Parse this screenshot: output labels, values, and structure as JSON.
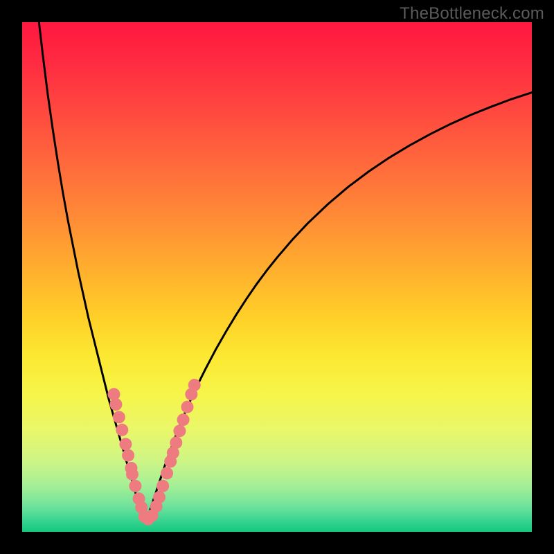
{
  "watermark": "TheBottleneck.com",
  "colors": {
    "curve_stroke": "#000000",
    "dot_fill": "#ee7b80",
    "dot_stroke": "#ee7b80",
    "background_black": "#000000"
  },
  "chart_data": {
    "type": "line",
    "title": "",
    "xlabel": "",
    "ylabel": "",
    "xlim": [
      0,
      100
    ],
    "ylim": [
      0,
      100
    ],
    "grid": false,
    "legend": false,
    "series": [
      {
        "name": "left-curve",
        "comment": "Steep descending curve from top-left toward the valley near x≈24",
        "x": [
          3.3,
          4,
          5,
          6,
          7,
          8,
          9,
          10,
          11,
          12,
          13,
          14,
          15,
          16,
          17,
          18,
          19,
          20,
          21,
          22,
          23,
          24
        ],
        "y": [
          100,
          94,
          86,
          79,
          72.5,
          66.5,
          61,
          56,
          51,
          46.5,
          42,
          38,
          34,
          30,
          26,
          22.5,
          19,
          15.5,
          12,
          8.5,
          5,
          2
        ]
      },
      {
        "name": "right-curve",
        "comment": "Ascending curve from the valley rising toward the right edge",
        "x": [
          24,
          25,
          26,
          27,
          28,
          30,
          32,
          34,
          36,
          38,
          40,
          42,
          44,
          46,
          48,
          50,
          53,
          56,
          60,
          64,
          68,
          72,
          76,
          80,
          84,
          88,
          92,
          96,
          100
        ],
        "y": [
          2,
          4,
          7,
          10,
          13,
          18.5,
          23.5,
          28,
          32,
          35.8,
          39.3,
          42.6,
          45.7,
          48.6,
          51.3,
          53.8,
          57.3,
          60.5,
          64.3,
          67.7,
          70.7,
          73.4,
          75.8,
          78,
          80,
          81.8,
          83.4,
          84.9,
          86.2
        ]
      }
    ],
    "dots": {
      "comment": "Salmon marker dots scattered on the lower portions of both curves",
      "points": [
        {
          "x": 18.0,
          "y": 27.0
        },
        {
          "x": 18.4,
          "y": 25.0
        },
        {
          "x": 19.0,
          "y": 22.5
        },
        {
          "x": 19.6,
          "y": 20.0
        },
        {
          "x": 20.3,
          "y": 17.2
        },
        {
          "x": 20.8,
          "y": 15.0
        },
        {
          "x": 21.4,
          "y": 12.5
        },
        {
          "x": 21.6,
          "y": 11.3
        },
        {
          "x": 22.2,
          "y": 9.0
        },
        {
          "x": 22.9,
          "y": 6.5
        },
        {
          "x": 23.4,
          "y": 4.8
        },
        {
          "x": 24.0,
          "y": 3.0
        },
        {
          "x": 24.7,
          "y": 2.5
        },
        {
          "x": 25.5,
          "y": 3.2
        },
        {
          "x": 26.3,
          "y": 5.0
        },
        {
          "x": 26.9,
          "y": 6.8
        },
        {
          "x": 27.6,
          "y": 9.0
        },
        {
          "x": 28.4,
          "y": 11.5
        },
        {
          "x": 29.1,
          "y": 13.8
        },
        {
          "x": 29.6,
          "y": 15.5
        },
        {
          "x": 30.2,
          "y": 17.5
        },
        {
          "x": 30.9,
          "y": 19.8
        },
        {
          "x": 31.6,
          "y": 22.0
        },
        {
          "x": 32.4,
          "y": 24.5
        },
        {
          "x": 33.2,
          "y": 27.0
        },
        {
          "x": 33.8,
          "y": 28.8
        }
      ],
      "radius_px": 9
    }
  }
}
